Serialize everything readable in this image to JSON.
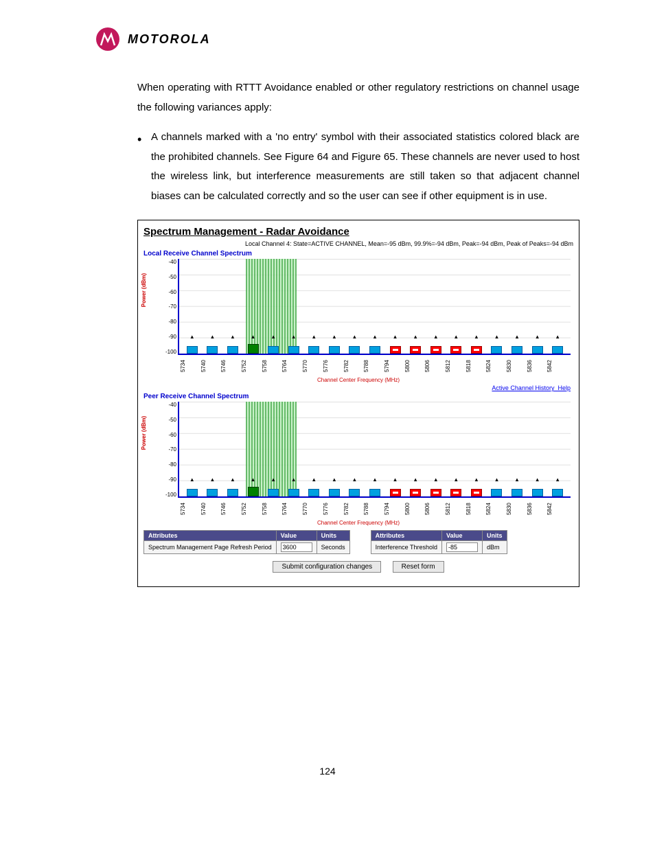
{
  "brand": "MOTOROLA",
  "page_number": "124",
  "para1": "When operating with RTTT Avoidance enabled or other regulatory restrictions on channel usage the following variances apply:",
  "bullet1": "A channels marked with a 'no entry' symbol with their associated statistics colored black are the prohibited channels. See Figure 64 and Figure 65. These channels are never used to host the wireless link, but interference measurements are still taken so that adjacent channel biases can be calculated correctly and so the user can see if other equipment is in use.",
  "figure": {
    "title": "Spectrum Management - Radar Avoidance",
    "status_line": "Local Channel 4: State=ACTIVE CHANNEL, Mean=-95 dBm, 99.9%=-94 dBm, Peak=-94 dBm, Peak of Peaks=-94 dBm",
    "chart1_label": "Local Receive Channel Spectrum",
    "chart2_label": "Peer Receive Channel Spectrum",
    "y_label": "Power (dBm)",
    "x_label": "Channel Center Frequency (MHz)",
    "link_history": "Active Channel History",
    "link_help": "Help",
    "table1": {
      "h1": "Attributes",
      "h2": "Value",
      "h3": "Units",
      "a": "Spectrum Management Page Refresh Period",
      "v": "3600",
      "u": "Seconds"
    },
    "table2": {
      "h1": "Attributes",
      "h2": "Value",
      "h3": "Units",
      "a": "Interference Threshold",
      "v": "-85",
      "u": "dBm"
    },
    "btn_submit": "Submit configuration changes",
    "btn_reset": "Reset form"
  },
  "chart_data": {
    "type": "bar",
    "ylabel": "Power (dBm)",
    "xlabel": "Channel Center Frequency (MHz)",
    "y_ticks": [
      "-40",
      "-50",
      "-60",
      "-70",
      "-80",
      "-90",
      "-100"
    ],
    "categories": [
      "5734",
      "5740",
      "5746",
      "5752",
      "5758",
      "5764",
      "5770",
      "5776",
      "5782",
      "5788",
      "5794",
      "5800",
      "5806",
      "5812",
      "5818",
      "5824",
      "5830",
      "5836",
      "5842"
    ],
    "bar_value_dBm": -95,
    "marker_value_dBm": -85,
    "active_channel_index": 3,
    "prohibited_indices": [
      10,
      11,
      12,
      13,
      14
    ],
    "green_band_indices": [
      2,
      3,
      4,
      5
    ],
    "series_note": "Both Local and Peer charts show identical channel layout; all bars at approx. -95 dBm with peak markers near -85 dBm. Indices 10-14 (5794–5818 MHz) are prohibited (red no-entry). Index 3 (5752) is the active channel.",
    "ylim": [
      -100,
      -40
    ]
  }
}
